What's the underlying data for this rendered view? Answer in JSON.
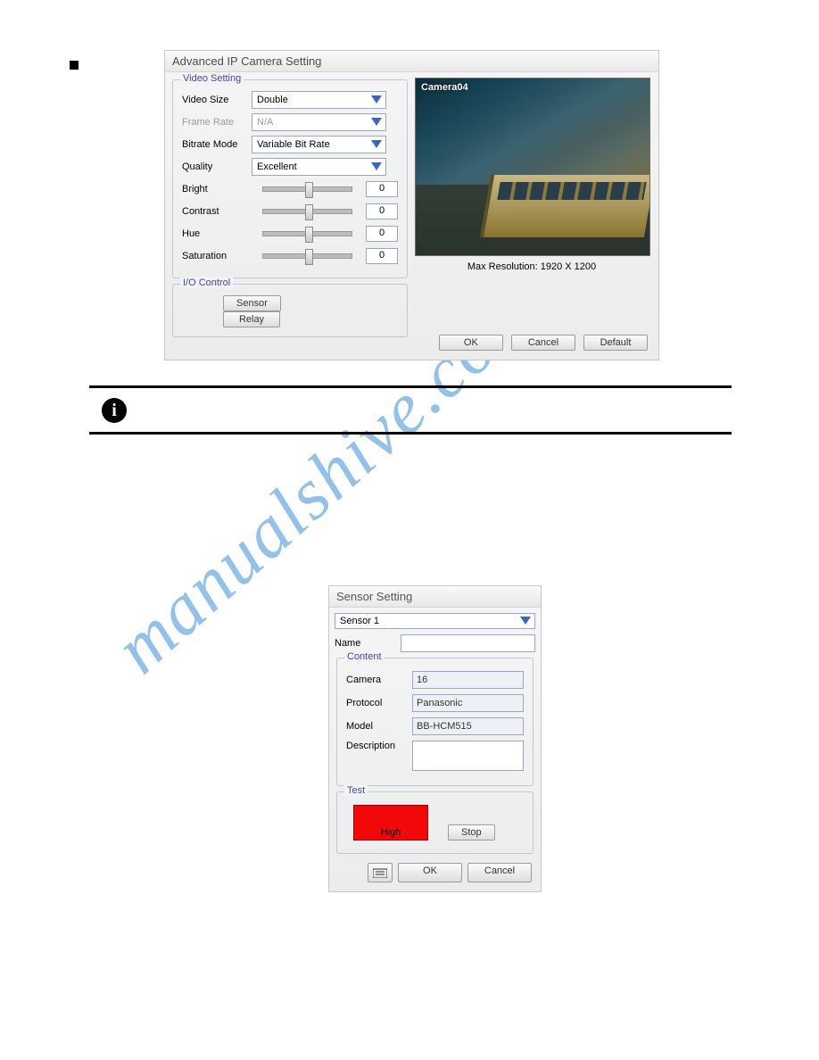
{
  "watermark": "manualshive.com",
  "advanced": {
    "title": "Advanced IP Camera Setting",
    "video_setting_legend": "Video Setting",
    "io_control_legend": "I/O Control",
    "fields": {
      "video_size": {
        "label": "Video Size",
        "value": "Double"
      },
      "frame_rate": {
        "label": "Frame Rate",
        "value": "N/A"
      },
      "bitrate_mode": {
        "label": "Bitrate Mode",
        "value": "Variable Bit Rate"
      },
      "quality": {
        "label": "Quality",
        "value": "Excellent"
      },
      "bright": {
        "label": "Bright",
        "value": "0"
      },
      "contrast": {
        "label": "Contrast",
        "value": "0"
      },
      "hue": {
        "label": "Hue",
        "value": "0"
      },
      "saturation": {
        "label": "Saturation",
        "value": "0"
      }
    },
    "io_buttons": {
      "sensor": "Sensor",
      "relay": "Relay"
    },
    "preview": {
      "camera_label": "Camera04",
      "max_resolution": "Max Resolution: 1920 X 1200"
    },
    "buttons": {
      "ok": "OK",
      "cancel": "Cancel",
      "default": "Default"
    }
  },
  "sensor": {
    "title": "Sensor Setting",
    "selector": "Sensor 1",
    "name_label": "Name",
    "name_value": "",
    "content_legend": "Content",
    "camera": {
      "label": "Camera",
      "value": "16"
    },
    "protocol": {
      "label": "Protocol",
      "value": "Panasonic"
    },
    "model": {
      "label": "Model",
      "value": "BB-HCM515"
    },
    "description": {
      "label": "Description",
      "value": ""
    },
    "test_legend": "Test",
    "test_status": "High",
    "stop": "Stop",
    "ok": "OK",
    "cancel": "Cancel"
  }
}
